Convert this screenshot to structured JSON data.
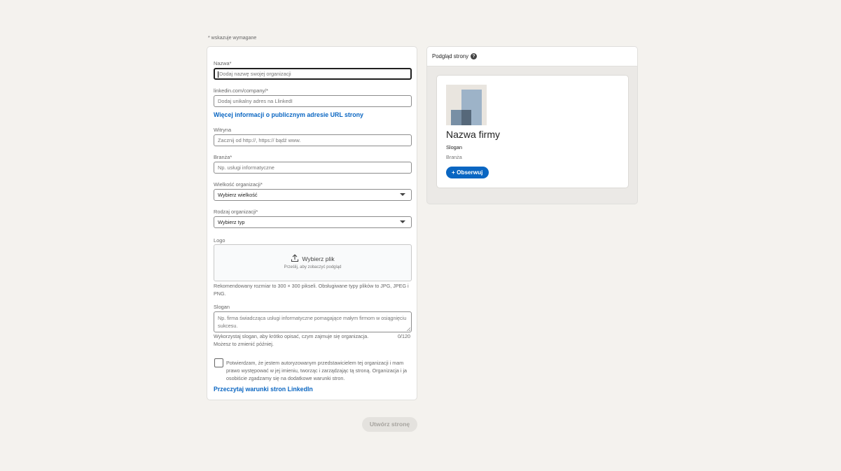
{
  "required_note": "*  wskazuje wymagane",
  "form": {
    "name": {
      "label": "Nazwa*",
      "placeholder": "Dodaj nazwę swojej organizacji"
    },
    "url": {
      "label": "linkedin.com/company/*",
      "placeholder": "Dodaj unikalny adres na LlinkedI",
      "info_link": "Więcej informacji o publicznym adresie URL strony"
    },
    "website": {
      "label": "Witryna",
      "placeholder": "Zacznij od http://, https:// bądź www."
    },
    "industry": {
      "label": "Branża*",
      "placeholder": "Np. usługi informatyczne"
    },
    "size": {
      "label": "Wielkość organizacji*",
      "selected": "Wybierz wielkość"
    },
    "type": {
      "label": "Rodzaj organizacji*",
      "selected": "Wybierz typ"
    },
    "logo": {
      "label": "Logo",
      "button": "Wybierz plik",
      "hint": "Prześlij, aby zobaczyć podgląd",
      "help": "Rekomendowany rozmiar to 300 × 300 pikseli. Obsługiwane typy plików to JPG, JPEG i PNG."
    },
    "tagline": {
      "label": "Slogan",
      "placeholder": "Np. firma świadcząca usługi informatyczne pomagające małym firmom w osiągnięciu sukcesu.",
      "help": "Wykorzystaj slogan, aby krótko opisać, czym zajmuje się organizacja. Możesz to zmienić później.",
      "counter": "0/120"
    },
    "consent": "Potwierdzam, że jestem autoryzowanym przedstawicielem tej organizacji i mam prawo występować w jej imieniu, tworząc i zarządzając tą stroną. Organizacja i ja osobiście zgadzamy się na dodatkowe warunki stron.",
    "terms_link": "Przeczytaj warunki stron LinkedIn"
  },
  "create_button": "Utwórz stronę",
  "preview": {
    "header": "Podgląd strony",
    "company_name": "Nazwa firmy",
    "tagline": "Slogan",
    "industry": "Branża",
    "follow_button": "Obserwuj"
  },
  "colors": {
    "accent": "#0a66c2",
    "background": "#f4f2ee"
  }
}
